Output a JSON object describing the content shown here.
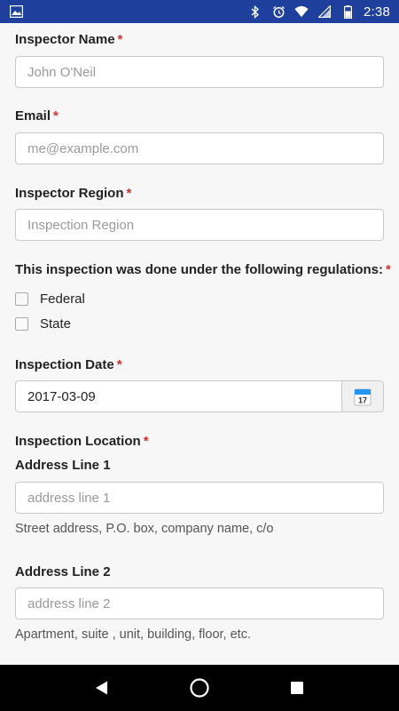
{
  "status_bar": {
    "time": "2:38",
    "icons": [
      "image-icon",
      "bluetooth-icon",
      "alarm-icon",
      "wifi-icon",
      "signal-icon",
      "battery-icon"
    ]
  },
  "form": {
    "inspector_name": {
      "label": "Inspector Name",
      "required": "*",
      "placeholder": "John O'Neil"
    },
    "email": {
      "label": "Email",
      "required": "*",
      "placeholder": "me@example.com"
    },
    "inspector_region": {
      "label": "Inspector Region",
      "required": "*",
      "placeholder": "Inspection Region"
    },
    "regulations": {
      "label": "This inspection was done under the following regulations:",
      "required": "*",
      "options": [
        {
          "label": "Federal",
          "checked": false
        },
        {
          "label": "State",
          "checked": false
        }
      ]
    },
    "inspection_date": {
      "label": "Inspection Date",
      "required": "*",
      "value": "2017-03-09",
      "calendar_icon_text": "17"
    },
    "inspection_location": {
      "label": "Inspection Location",
      "required": "*"
    },
    "address_line_1": {
      "label": "Address Line 1",
      "placeholder": "address line 1",
      "helper": "Street address, P.O. box, company name, c/o"
    },
    "address_line_2": {
      "label": "Address Line 2",
      "placeholder": "address line 2",
      "helper": "Apartment, suite , unit, building, floor, etc."
    }
  },
  "nav_bar": {
    "buttons": [
      "back-icon",
      "home-icon",
      "recents-icon"
    ]
  },
  "colors": {
    "status_bar": "#1f3f9c",
    "required": "#d32f2f",
    "nav_bar": "#000000"
  }
}
